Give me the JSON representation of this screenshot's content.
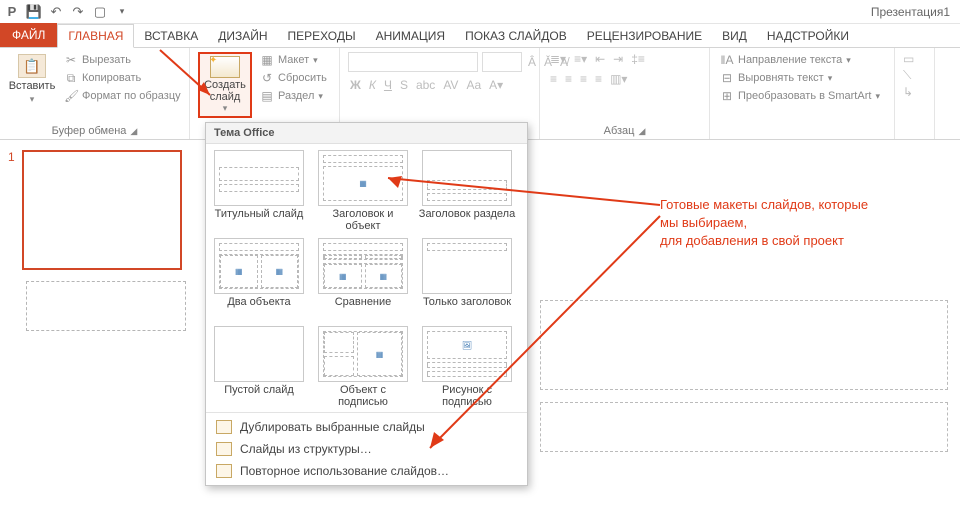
{
  "titlebar": {
    "doc_title": "Презентация1"
  },
  "tabs": {
    "file": "ФАЙЛ",
    "home": "ГЛАВНАЯ",
    "insert": "ВСТАВКА",
    "design": "ДИЗАЙН",
    "transitions": "ПЕРЕХОДЫ",
    "animation": "АНИМАЦИЯ",
    "slideshow": "ПОКАЗ СЛАЙДОВ",
    "review": "РЕЦЕНЗИРОВАНИЕ",
    "view": "ВИД",
    "addins": "НАДСТРОЙКИ"
  },
  "ribbon": {
    "paste": "Вставить",
    "cut": "Вырезать",
    "copy": "Копировать",
    "format_painter": "Формат по образцу",
    "clipboard_group": "Буфер обмена",
    "new_slide": "Создать слайд",
    "layout": "Макет",
    "reset": "Сбросить",
    "section": "Раздел",
    "para_group": "Абзац",
    "text_dir": "Направление текста",
    "align_text": "Выровнять текст",
    "smartart": "Преобразовать в SmartArt"
  },
  "slidepane": {
    "num": "1"
  },
  "gallery": {
    "header": "Тема Office",
    "layouts": [
      "Титульный слайд",
      "Заголовок и объект",
      "Заголовок раздела",
      "Два объекта",
      "Сравнение",
      "Только заголовок",
      "Пустой слайд",
      "Объект с подписью",
      "Рисунок с подписью"
    ],
    "cmd_duplicate": "Дублировать выбранные слайды",
    "cmd_outline": "Слайды из структуры…",
    "cmd_reuse": "Повторное использование слайдов…"
  },
  "annotation": {
    "line1": "Готовые макеты слайдов, которые",
    "line2": "мы выбираем,",
    "line3": "для добавления в свой проект"
  }
}
